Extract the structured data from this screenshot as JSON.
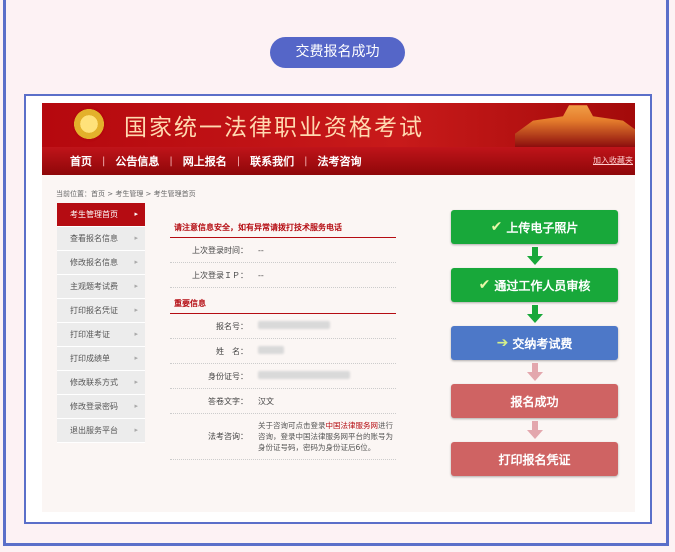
{
  "header": {
    "title": "交费报名成功"
  },
  "site": {
    "banner_title": "国家统一法律职业资格考试",
    "nav": [
      "首页",
      "公告信息",
      "网上报名",
      "联系我们",
      "法考咨询"
    ],
    "nav_separator": "|",
    "favorite_link": "加入收藏夹",
    "breadcrumb": "当前位置：首页 > 考生管理 > 考生管理首页"
  },
  "sidemenu": [
    {
      "label": "考生管理首页",
      "active": true
    },
    {
      "label": "查看报名信息"
    },
    {
      "label": "修改报名信息"
    },
    {
      "label": "主观题考试费"
    },
    {
      "label": "打印报名凭证"
    },
    {
      "label": "打印准考证"
    },
    {
      "label": "打印成绩单"
    },
    {
      "label": "修改联系方式"
    },
    {
      "label": "修改登录密码"
    },
    {
      "label": "退出服务平台"
    }
  ],
  "info": {
    "notice": "请注意信息安全，如有异常请拨打技术服务电话",
    "last_login_time_label": "上次登录时间：",
    "last_login_time_value": "--",
    "last_login_ip_label": "上次登录ＩＰ：",
    "last_login_ip_value": "--",
    "section_title": "重要信息",
    "reg_no_label": "报名号：",
    "name_label": "姓　名：",
    "id_label": "身份证号：",
    "paper_lang_label": "答卷文字：",
    "paper_lang_value": "汉文",
    "consult_label": "法考咨询：",
    "consult_pre": "关于咨询可点击登录",
    "consult_link": "中国法律服务网",
    "consult_post": "进行咨询，登录中国法律服务网平台的账号为身份证号码，密码为身份证后6位。"
  },
  "flow": {
    "steps": [
      {
        "label": "上传电子照片",
        "icon": "check-icon",
        "color": "#18a83a",
        "icon_char": "✔"
      },
      {
        "label": "通过工作人员审核",
        "icon": "check-icon",
        "color": "#18a83a",
        "icon_char": "✔"
      },
      {
        "label": "交纳考试费",
        "icon": "arrow-right-icon",
        "color": "#4d78c8",
        "icon_char": "➔"
      },
      {
        "label": "报名成功",
        "icon": "",
        "color": "#cf6363",
        "icon_char": ""
      },
      {
        "label": "打印报名凭证",
        "icon": "",
        "color": "#cf6363",
        "icon_char": ""
      }
    ],
    "arrow_colors": [
      "#18a83a",
      "#18a83a",
      "#e3a7ad",
      "#e3a7ad"
    ]
  },
  "colors": {
    "accent": "#5566c8",
    "brand_red": "#b50c12"
  }
}
